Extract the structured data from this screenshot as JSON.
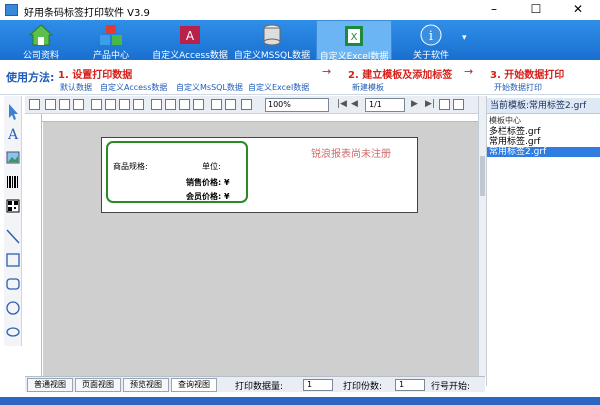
{
  "window": {
    "title": "好用条码标签打印软件 V3.9",
    "controls": [
      "–",
      "☐",
      "✕"
    ]
  },
  "toolbar": {
    "items": [
      {
        "label": "公司资料",
        "icon": "home-icon"
      },
      {
        "label": "产品中心",
        "icon": "cubes-icon"
      },
      {
        "label": "自定义Access数据",
        "icon": "access-icon"
      },
      {
        "label": "自定义MSSQL数据",
        "icon": "database-icon"
      },
      {
        "label": "自定义Excel数据",
        "icon": "excel-icon"
      },
      {
        "label": "关于软件",
        "icon": "info-icon"
      }
    ],
    "more": "▾"
  },
  "guide": {
    "label": "使用方法:",
    "step1": "1. 设置打印数据",
    "step1_subs": [
      "默认数据",
      "自定义Access数据",
      "自定义MsSQL数据",
      "自定义Excel数据"
    ],
    "step2": "2. 建立模板及添加标签",
    "step2_sub": "新建模板",
    "step3": "3. 开始数据打印",
    "step3_sub": "开始数据打印",
    "arrow": "→"
  },
  "editor": {
    "zoom": "100%",
    "page": "1/1"
  },
  "label": {
    "spec": "商品规格:",
    "unit": "单位:",
    "sale_price": "销售价格: ¥",
    "member_price": "会员价格: ¥",
    "watermark": "锐浪报表尚未注册"
  },
  "right": {
    "current": "当前模板:常用标签2.grf",
    "header": "模板中心",
    "items": [
      "多栏标签.grf",
      "常用标签.grf",
      "常用标签2.grf"
    ],
    "selected_index": 2
  },
  "bottom": {
    "tabs": [
      "普通视图",
      "页面视图",
      "预览视图",
      "查询视图"
    ],
    "print_count_label": "打印数据量:",
    "print_count": "1",
    "copies_label": "打印份数:",
    "copies": "1",
    "start_row_label": "行号开始:"
  },
  "colors": {
    "toolbar": "#1a6fd0",
    "accent_red": "#d6201b",
    "accent_blue": "#1e5bb8",
    "label_border": "#2a8a28"
  }
}
